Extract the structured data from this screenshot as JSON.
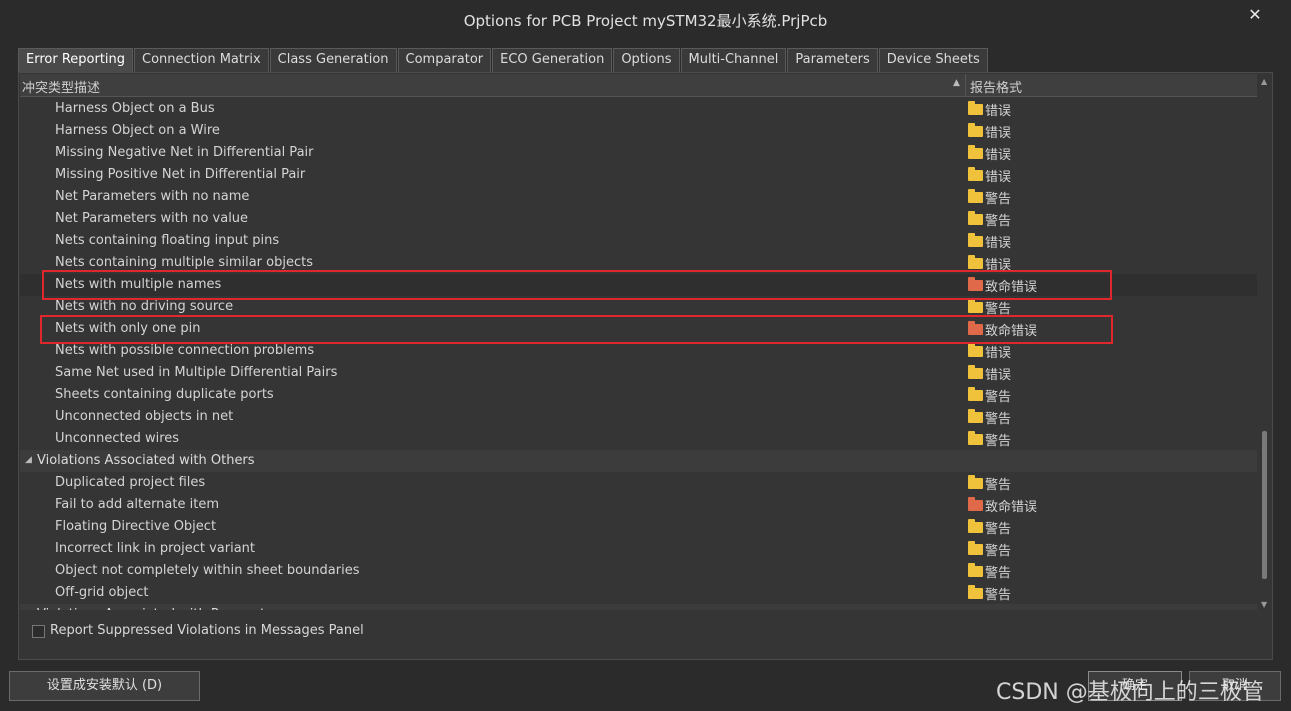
{
  "window": {
    "title": "Options for PCB Project mySTM32最小系统.PrjPcb",
    "close_glyph": "✕"
  },
  "tabs": [
    {
      "label": "Error Reporting",
      "active": true
    },
    {
      "label": "Connection Matrix"
    },
    {
      "label": "Class Generation"
    },
    {
      "label": "Comparator"
    },
    {
      "label": "ECO Generation"
    },
    {
      "label": "Options"
    },
    {
      "label": "Multi-Channel"
    },
    {
      "label": "Parameters"
    },
    {
      "label": "Device Sheets"
    }
  ],
  "grid": {
    "col_description": "冲突类型描述",
    "col_report_mode": "报告格式",
    "sort_glyph": "▲",
    "rows": [
      {
        "name": "Harness Object on a Bus",
        "level": "错误",
        "color": "yellow"
      },
      {
        "name": "Harness Object on a Wire",
        "level": "错误",
        "color": "yellow"
      },
      {
        "name": "Missing Negative Net in Differential Pair",
        "level": "错误",
        "color": "yellow"
      },
      {
        "name": "Missing Positive Net in Differential Pair",
        "level": "错误",
        "color": "yellow"
      },
      {
        "name": "Net Parameters with no name",
        "level": "警告",
        "color": "yellow"
      },
      {
        "name": "Net Parameters with no value",
        "level": "警告",
        "color": "yellow"
      },
      {
        "name": "Nets containing floating input pins",
        "level": "错误",
        "color": "yellow"
      },
      {
        "name": "Nets containing multiple similar objects",
        "level": "错误",
        "color": "yellow"
      },
      {
        "name": "Nets with multiple names",
        "level": "致命错误",
        "color": "red",
        "selected": true
      },
      {
        "name": "Nets with no driving source",
        "level": "警告",
        "color": "yellow"
      },
      {
        "name": "Nets with only one pin",
        "level": "致命错误",
        "color": "red"
      },
      {
        "name": "Nets with possible connection problems",
        "level": "错误",
        "color": "yellow"
      },
      {
        "name": "Same Net used in Multiple Differential Pairs",
        "level": "错误",
        "color": "yellow"
      },
      {
        "name": "Sheets containing duplicate ports",
        "level": "警告",
        "color": "yellow"
      },
      {
        "name": "Unconnected objects in net",
        "level": "警告",
        "color": "yellow"
      },
      {
        "name": "Unconnected wires",
        "level": "警告",
        "color": "yellow"
      },
      {
        "name": "Violations Associated with Others",
        "group": true,
        "expanded": true
      },
      {
        "name": "Duplicated project files",
        "level": "警告",
        "color": "yellow"
      },
      {
        "name": "Fail to add alternate item",
        "level": "致命错误",
        "color": "red"
      },
      {
        "name": "Floating Directive Object",
        "level": "警告",
        "color": "yellow"
      },
      {
        "name": "Incorrect link in project variant",
        "level": "警告",
        "color": "yellow"
      },
      {
        "name": "Object not completely within sheet boundaries",
        "level": "警告",
        "color": "yellow"
      },
      {
        "name": "Off-grid object",
        "level": "警告",
        "color": "yellow"
      },
      {
        "name": "Violations Associated with Parameters",
        "group": true,
        "expanded": false
      }
    ]
  },
  "colors": {
    "folder_yellow": "#f0c13a",
    "folder_red": "#e0694a",
    "highlight_border": "#e0282c"
  },
  "options": {
    "report_suppressed_label": "Report Suppressed Violations in Messages Panel",
    "report_suppressed_checked": false
  },
  "buttons": {
    "set_default": "设置成安装默认 (D)",
    "ok": "确定",
    "cancel": "取消"
  },
  "watermark": "CSDN @基极向上的三极管"
}
